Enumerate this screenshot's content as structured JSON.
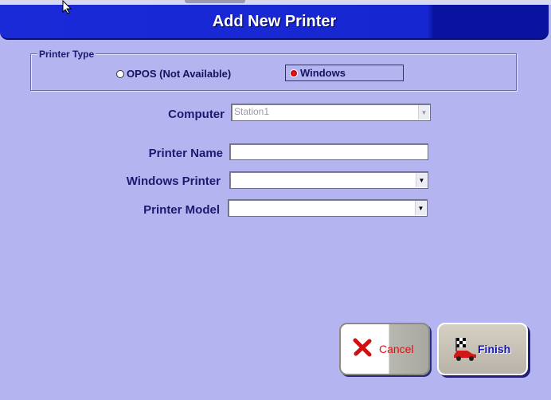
{
  "dialog": {
    "title": "Add New Printer"
  },
  "printer_type": {
    "legend": "Printer Type",
    "options": [
      {
        "label": "OPOS (Not Available)",
        "selected": false
      },
      {
        "label": "Windows",
        "selected": true
      }
    ]
  },
  "form": {
    "computer_label": "Computer",
    "computer_value": "Station1",
    "printer_name_label": "Printer Name",
    "printer_name_value": "",
    "windows_printer_label": "Windows Printer",
    "windows_printer_value": "",
    "printer_model_label": "Printer Model",
    "printer_model_value": ""
  },
  "buttons": {
    "cancel_label": "Cancel",
    "cancel_icon": "red-x-icon",
    "finish_label": "Finish",
    "finish_icon": "race-car-checkered-flag-icon"
  },
  "colors": {
    "background": "#b4b4f0",
    "titlebar": "#1626d0",
    "accent_red": "#e01010"
  }
}
